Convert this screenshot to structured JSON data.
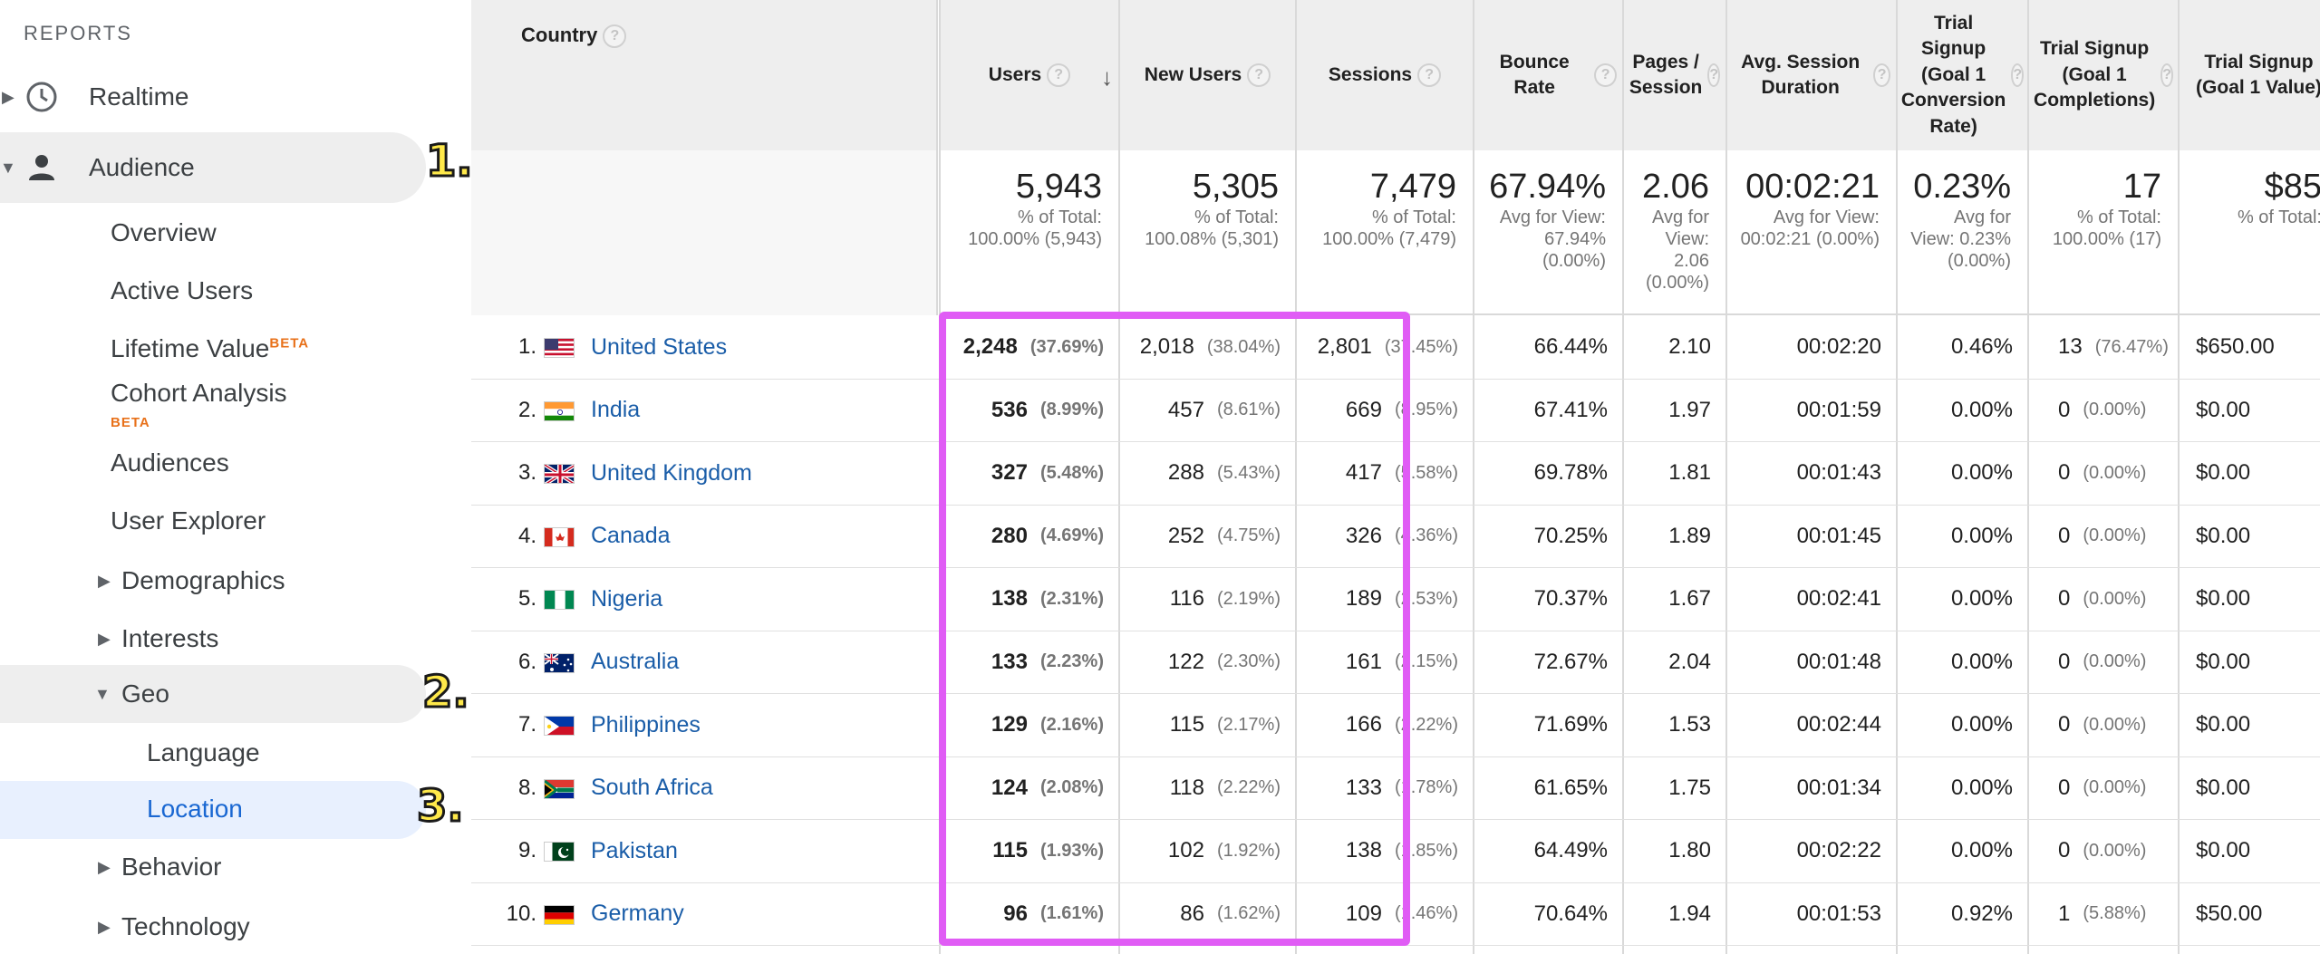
{
  "sidebar": {
    "section_title": "REPORTS",
    "realtime": "Realtime",
    "audience": "Audience",
    "items": [
      {
        "label": "Overview"
      },
      {
        "label": "Active Users"
      },
      {
        "label": "Lifetime Value",
        "beta": "BETA"
      },
      {
        "label": "Cohort Analysis",
        "beta": "BETA"
      },
      {
        "label": "Audiences"
      },
      {
        "label": "User Explorer"
      },
      {
        "label": "Demographics"
      },
      {
        "label": "Interests"
      },
      {
        "label": "Geo"
      },
      {
        "label": "Language"
      },
      {
        "label": "Location"
      },
      {
        "label": "Behavior"
      },
      {
        "label": "Technology"
      }
    ],
    "badges": [
      "1.",
      "2.",
      "3."
    ],
    "colors": {
      "selected_bg": "#e8f0fe",
      "hover_bg": "#eeeeee",
      "selected_text": "#1967d2",
      "badge": "#ffe94a"
    }
  },
  "table": {
    "dimension_header": "Country",
    "help_glyph": "?",
    "sort_glyph": "↓",
    "columns": [
      {
        "key": "users",
        "label": "Users",
        "help": true,
        "total": "5,943",
        "total_sub": "% of Total: 100.00% (5,943)"
      },
      {
        "key": "new_users",
        "label": "New Users",
        "help": true,
        "total": "5,305",
        "total_sub": "% of Total: 100.08% (5,301)"
      },
      {
        "key": "sessions",
        "label": "Sessions",
        "help": true,
        "total": "7,479",
        "total_sub": "% of Total: 100.00% (7,479)"
      },
      {
        "key": "bounce",
        "label": "Bounce Rate",
        "help": true,
        "total": "67.94%",
        "total_sub": "Avg for View: 67.94% (0.00%)"
      },
      {
        "key": "pages",
        "label": "Pages / Session",
        "help": true,
        "total": "2.06",
        "total_sub": "Avg for View: 2.06 (0.00%)"
      },
      {
        "key": "duration",
        "label": "Avg. Session Duration",
        "help": true,
        "total": "00:02:21",
        "total_sub": "Avg for View: 00:02:21 (0.00%)"
      },
      {
        "key": "conv",
        "label": "Trial Signup (Goal 1 Conversion Rate)",
        "help": true,
        "total": "0.23%",
        "total_sub": "Avg for View: 0.23% (0.00%)"
      },
      {
        "key": "compl",
        "label": "Trial Signup (Goal 1 Completions)",
        "help": true,
        "total": "17",
        "total_sub": "% of Total: 100.00% (17)"
      },
      {
        "key": "value",
        "label": "Trial Signup (Goal 1 Value)",
        "help": false,
        "total": "$85",
        "total_sub": "% of Total:"
      }
    ],
    "rows": [
      {
        "rank": "1.",
        "country": "United States",
        "flag": "us",
        "users": "2,248",
        "users_pct": "(37.69%)",
        "new_users": "2,018",
        "new_users_pct": "(38.04%)",
        "sessions": "2,801",
        "sessions_pct": "(37.45%)",
        "bounce": "66.44%",
        "pages": "2.10",
        "duration": "00:02:20",
        "conv": "0.46%",
        "compl": "13",
        "compl_pct": "(76.47%)",
        "value": "$650.00"
      },
      {
        "rank": "2.",
        "country": "India",
        "flag": "in",
        "users": "536",
        "users_pct": "(8.99%)",
        "new_users": "457",
        "new_users_pct": "(8.61%)",
        "sessions": "669",
        "sessions_pct": "(8.95%)",
        "bounce": "67.41%",
        "pages": "1.97",
        "duration": "00:01:59",
        "conv": "0.00%",
        "compl": "0",
        "compl_pct": "(0.00%)",
        "value": "$0.00"
      },
      {
        "rank": "3.",
        "country": "United Kingdom",
        "flag": "gb",
        "users": "327",
        "users_pct": "(5.48%)",
        "new_users": "288",
        "new_users_pct": "(5.43%)",
        "sessions": "417",
        "sessions_pct": "(5.58%)",
        "bounce": "69.78%",
        "pages": "1.81",
        "duration": "00:01:43",
        "conv": "0.00%",
        "compl": "0",
        "compl_pct": "(0.00%)",
        "value": "$0.00"
      },
      {
        "rank": "4.",
        "country": "Canada",
        "flag": "ca",
        "users": "280",
        "users_pct": "(4.69%)",
        "new_users": "252",
        "new_users_pct": "(4.75%)",
        "sessions": "326",
        "sessions_pct": "(4.36%)",
        "bounce": "70.25%",
        "pages": "1.89",
        "duration": "00:01:45",
        "conv": "0.00%",
        "compl": "0",
        "compl_pct": "(0.00%)",
        "value": "$0.00"
      },
      {
        "rank": "5.",
        "country": "Nigeria",
        "flag": "ng",
        "users": "138",
        "users_pct": "(2.31%)",
        "new_users": "116",
        "new_users_pct": "(2.19%)",
        "sessions": "189",
        "sessions_pct": "(2.53%)",
        "bounce": "70.37%",
        "pages": "1.67",
        "duration": "00:02:41",
        "conv": "0.00%",
        "compl": "0",
        "compl_pct": "(0.00%)",
        "value": "$0.00"
      },
      {
        "rank": "6.",
        "country": "Australia",
        "flag": "au",
        "users": "133",
        "users_pct": "(2.23%)",
        "new_users": "122",
        "new_users_pct": "(2.30%)",
        "sessions": "161",
        "sessions_pct": "(2.15%)",
        "bounce": "72.67%",
        "pages": "2.04",
        "duration": "00:01:48",
        "conv": "0.00%",
        "compl": "0",
        "compl_pct": "(0.00%)",
        "value": "$0.00"
      },
      {
        "rank": "7.",
        "country": "Philippines",
        "flag": "ph",
        "users": "129",
        "users_pct": "(2.16%)",
        "new_users": "115",
        "new_users_pct": "(2.17%)",
        "sessions": "166",
        "sessions_pct": "(2.22%)",
        "bounce": "71.69%",
        "pages": "1.53",
        "duration": "00:02:44",
        "conv": "0.00%",
        "compl": "0",
        "compl_pct": "(0.00%)",
        "value": "$0.00"
      },
      {
        "rank": "8.",
        "country": "South Africa",
        "flag": "za",
        "users": "124",
        "users_pct": "(2.08%)",
        "new_users": "118",
        "new_users_pct": "(2.22%)",
        "sessions": "133",
        "sessions_pct": "(1.78%)",
        "bounce": "61.65%",
        "pages": "1.75",
        "duration": "00:01:34",
        "conv": "0.00%",
        "compl": "0",
        "compl_pct": "(0.00%)",
        "value": "$0.00"
      },
      {
        "rank": "9.",
        "country": "Pakistan",
        "flag": "pk",
        "users": "115",
        "users_pct": "(1.93%)",
        "new_users": "102",
        "new_users_pct": "(1.92%)",
        "sessions": "138",
        "sessions_pct": "(1.85%)",
        "bounce": "64.49%",
        "pages": "1.80",
        "duration": "00:02:22",
        "conv": "0.00%",
        "compl": "0",
        "compl_pct": "(0.00%)",
        "value": "$0.00"
      },
      {
        "rank": "10.",
        "country": "Germany",
        "flag": "de",
        "users": "96",
        "users_pct": "(1.61%)",
        "new_users": "86",
        "new_users_pct": "(1.62%)",
        "sessions": "109",
        "sessions_pct": "(1.46%)",
        "bounce": "70.64%",
        "pages": "1.94",
        "duration": "00:01:53",
        "conv": "0.92%",
        "compl": "1",
        "compl_pct": "(5.88%)",
        "value": "$50.00"
      }
    ],
    "colors": {
      "link": "#1a5da8",
      "highlight_border": "#e05cf5"
    }
  }
}
